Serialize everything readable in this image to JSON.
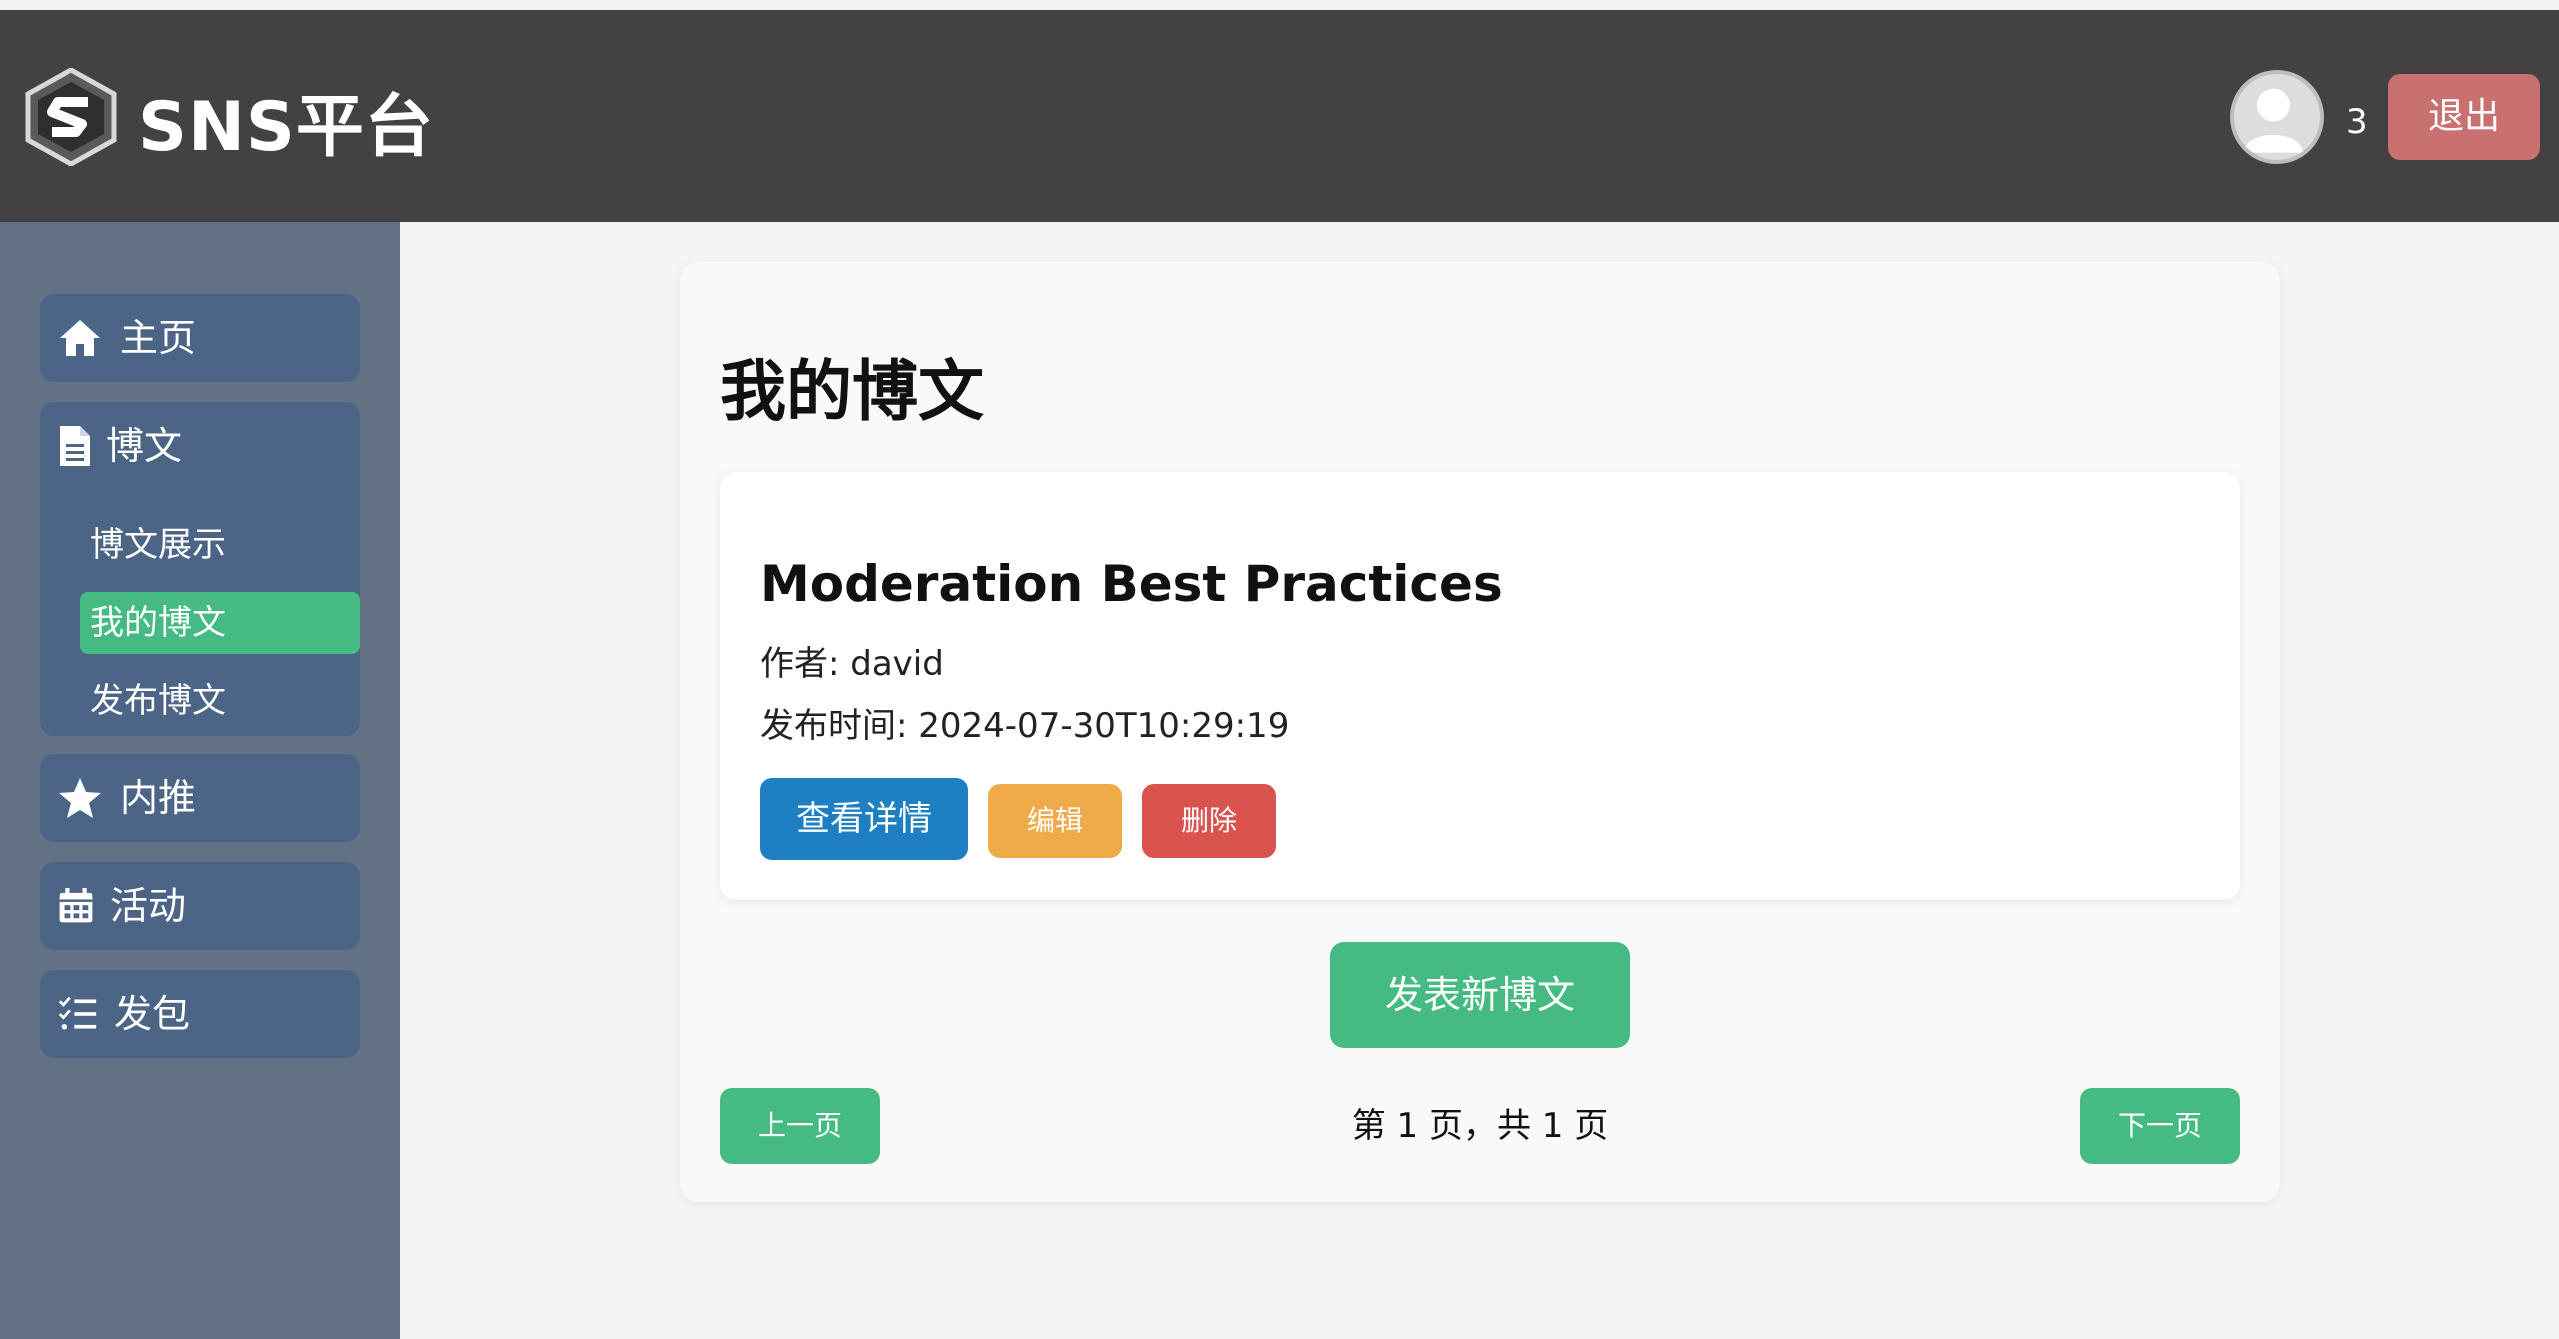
{
  "header": {
    "brand": "SNS平台",
    "user_count": "3",
    "logout_label": "退出"
  },
  "sidebar": {
    "items": [
      {
        "label": "主页",
        "icon": "home-icon"
      },
      {
        "label": "博文",
        "icon": "document-icon",
        "children": [
          {
            "label": "博文展示",
            "active": false
          },
          {
            "label": "我的博文",
            "active": true
          },
          {
            "label": "发布博文",
            "active": false
          }
        ]
      },
      {
        "label": "内推",
        "icon": "star-icon"
      },
      {
        "label": "活动",
        "icon": "calendar-icon"
      },
      {
        "label": "发包",
        "icon": "checklist-icon"
      }
    ]
  },
  "main": {
    "title": "我的博文",
    "posts": [
      {
        "title": "Moderation Best Practices",
        "author": "作者: david",
        "published": "发布时间: 2024-07-30T10:29:19",
        "detail_label": "查看详情",
        "edit_label": "编辑",
        "delete_label": "删除"
      }
    ],
    "new_post_label": "发表新博文",
    "pagination": {
      "prev_label": "上一页",
      "next_label": "下一页",
      "info": "第 1 页，共 1 页"
    }
  },
  "colors": {
    "header_bg": "#444142",
    "sidebar_bg": "#627183",
    "nav_item_bg": "#4c6586",
    "accent_green": "#45ba82",
    "blue": "#1e7fc2",
    "orange": "#efab4a",
    "red": "#d9534f",
    "logout": "#c97171"
  }
}
